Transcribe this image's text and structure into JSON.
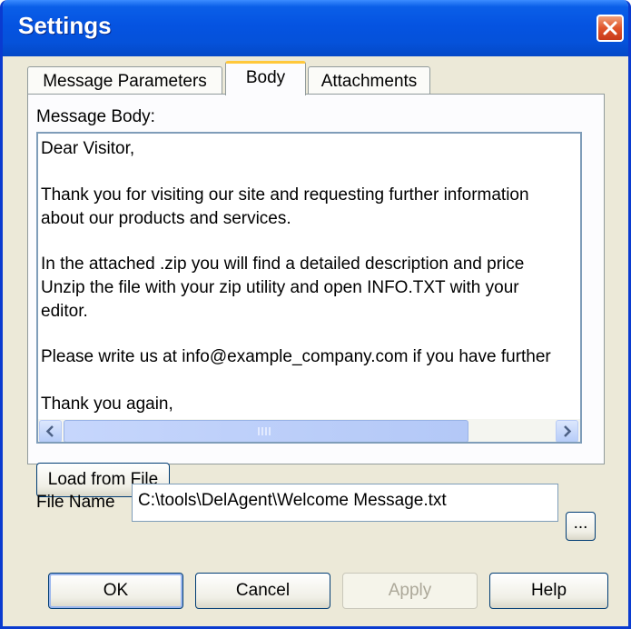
{
  "window": {
    "title": "Settings"
  },
  "tabs": [
    {
      "label": "Message Parameters",
      "active": false
    },
    {
      "label": "Body",
      "active": true
    },
    {
      "label": "Attachments",
      "active": false
    }
  ],
  "body": {
    "message_body_label": "Message Body:",
    "lines": [
      "Dear Visitor,",
      "",
      "Thank you for visiting our site and requesting further information",
      "about our products and services.",
      "",
      "In the attached .zip you will find a detailed description and price",
      "Unzip the file with your zip utility and open INFO.TXT with your",
      "editor.",
      "",
      "Please write us at info@example_company.com if you have further",
      "",
      "Thank you again,"
    ],
    "load_button": "Load from File",
    "file_name_label": "File Name",
    "file_name_value": "C:\\tools\\DelAgent\\Welcome Message.txt",
    "browse_button": "..."
  },
  "footer": {
    "ok": "OK",
    "cancel": "Cancel",
    "apply": "Apply",
    "help": "Help"
  },
  "icons": {
    "close": "close-icon",
    "scroll_up": "arrow-up-icon",
    "scroll_down": "arrow-down-icon",
    "scroll_left": "arrow-left-icon",
    "scroll_right": "arrow-right-icon",
    "grip": "grip-icon"
  },
  "colors": {
    "titlebar": "#0553e1",
    "window_face": "#ece9d8",
    "active_tab_accent": "#ffc83c",
    "close_button": "#e0542a"
  }
}
